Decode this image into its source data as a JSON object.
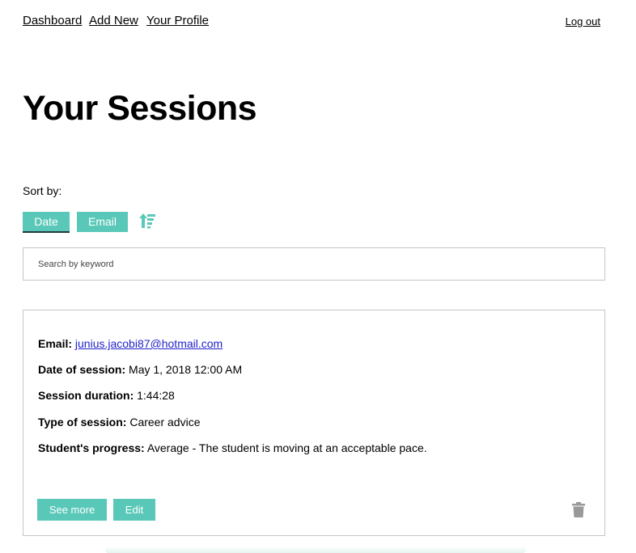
{
  "nav": {
    "dashboard": "Dashboard",
    "add_new": "Add New",
    "your_profile": "Your Profile",
    "log_out": "Log out"
  },
  "page_title": "Your Sessions",
  "sort": {
    "label": "Sort by:",
    "date": "Date",
    "email": "Email",
    "active": "Date",
    "direction_icon": "sort-ascending-icon"
  },
  "search": {
    "placeholder": "Search by keyword",
    "value": ""
  },
  "session": {
    "email_label": "Email:",
    "email": "junius.jacobi87@hotmail.com",
    "date_label": "Date of session:",
    "date": "May 1, 2018 12:00 AM",
    "duration_label": "Session duration:",
    "duration": "1:44:28",
    "type_label": "Type of session:",
    "type": "Career advice",
    "progress_label": "Student's progress:",
    "progress": "Average - The student is moving at an acceptable pace.",
    "see_more": "See more",
    "edit": "Edit",
    "delete_icon": "trash-icon"
  },
  "colors": {
    "accent": "#5ac8b8",
    "active_underline": "#1f3b3d",
    "link": "#2222cc",
    "trash": "#999999"
  }
}
